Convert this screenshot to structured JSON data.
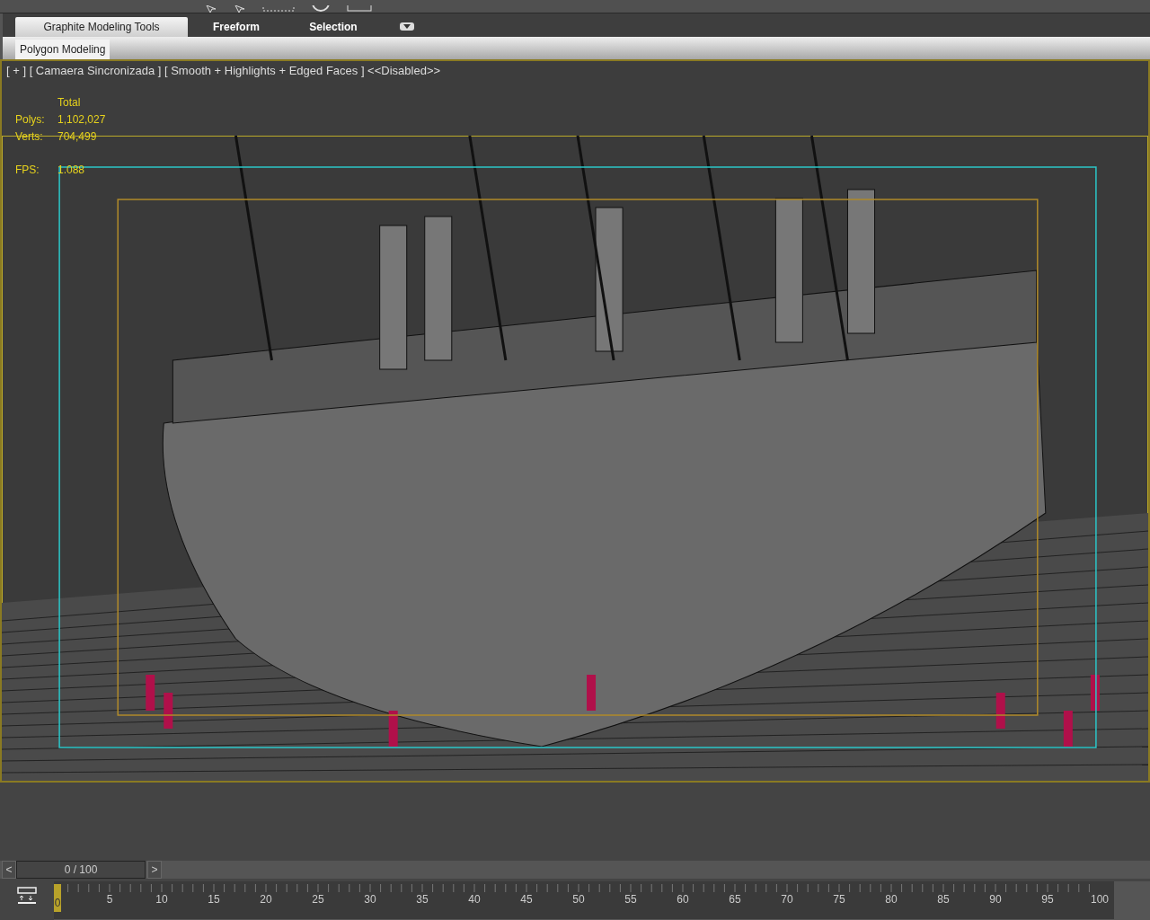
{
  "ribbon": {
    "tabs": [
      {
        "label": "Graphite Modeling Tools",
        "selected": true
      },
      {
        "label": "Freeform",
        "selected": false
      },
      {
        "label": "Selection",
        "selected": false
      }
    ],
    "panels": [
      {
        "label": "Polygon Modeling",
        "selected": true
      }
    ]
  },
  "viewport": {
    "label": "[ + ] [ Camaera Sincronizada ] [ Smooth + Highlights + Edged Faces ] <<Disabled>>",
    "stats": {
      "header": "Total",
      "rows": [
        {
          "name": "Polys:",
          "value": "1,102,027"
        },
        {
          "name": "Verts:",
          "value": "704,499"
        }
      ],
      "fps_label": "FPS:",
      "fps_value": "1.088"
    }
  },
  "time_slider": {
    "prev": "<",
    "next": ">",
    "position": "0 / 100",
    "level": 0
  },
  "track_bar": {
    "labels": [
      {
        "label": "0",
        "selected": true
      },
      {
        "label": "5",
        "selected": false
      },
      {
        "label": "10",
        "selected": false
      },
      {
        "label": "15",
        "selected": false
      },
      {
        "label": "20",
        "selected": false
      },
      {
        "label": "25",
        "selected": false
      },
      {
        "label": "30",
        "selected": false
      },
      {
        "label": "35",
        "selected": false
      },
      {
        "label": "40",
        "selected": false
      },
      {
        "label": "45",
        "selected": false
      },
      {
        "label": "50",
        "selected": false
      },
      {
        "label": "55",
        "selected": false
      },
      {
        "label": "60",
        "selected": false
      },
      {
        "label": "65",
        "selected": false
      },
      {
        "label": "70",
        "selected": false
      },
      {
        "label": "75",
        "selected": false
      },
      {
        "label": "80",
        "selected": false
      },
      {
        "label": "85",
        "selected": false
      },
      {
        "label": "90",
        "selected": false
      },
      {
        "label": "95",
        "selected": false
      },
      {
        "label": "100",
        "selected": false
      }
    ]
  }
}
